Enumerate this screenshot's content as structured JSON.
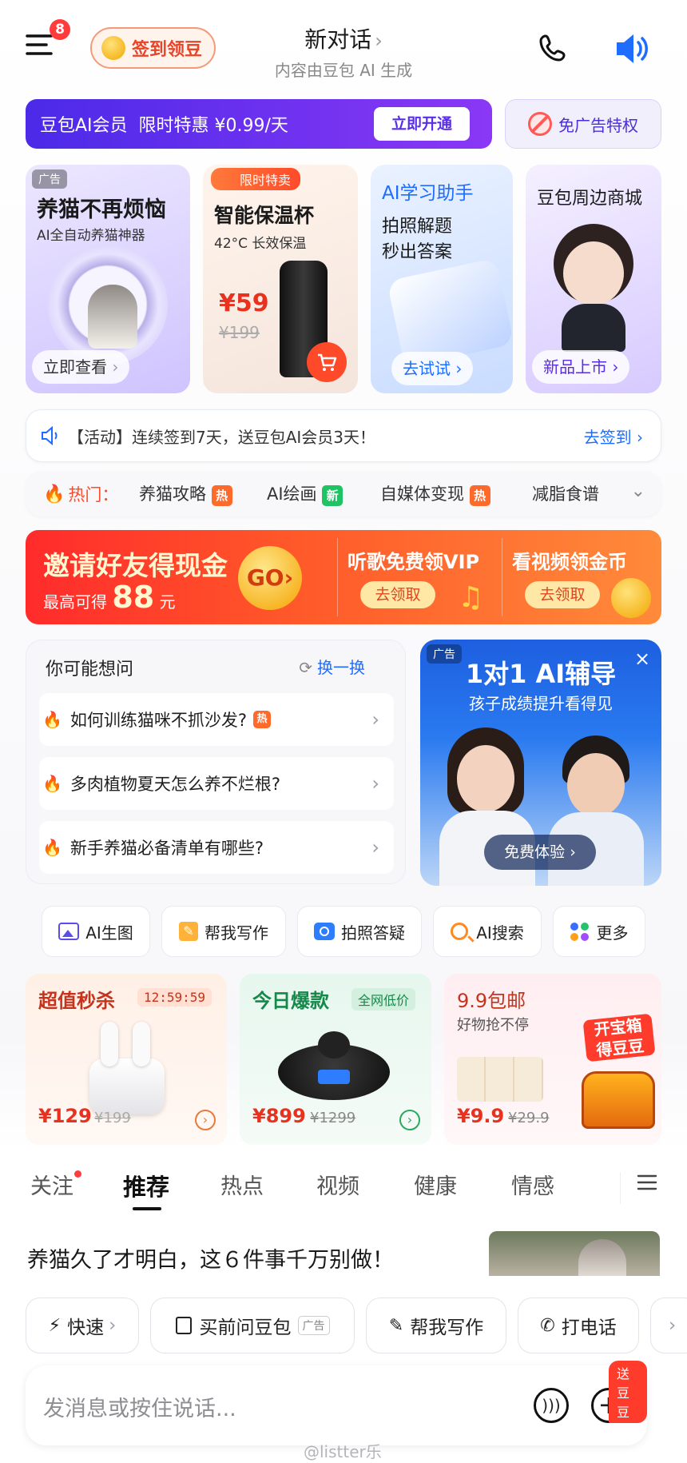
{
  "header": {
    "menu_badge": "8",
    "checkin_label": "签到领豆",
    "title": "新对话",
    "subtitle": "内容由豆包 AI 生成"
  },
  "member_banner": {
    "text": "豆包AI会员  限时特惠 ¥0.99/天",
    "cta": "立即开通",
    "adfree": "免广告特权"
  },
  "promo_cards": [
    {
      "ad_tag": "广告",
      "title": "养猫不再烦恼",
      "subtitle": "AI全自动养猫神器",
      "cta": "立即查看"
    },
    {
      "tag": "限时特卖",
      "title": "智能保温杯",
      "subtitle": "42°C 长效保温",
      "price": "¥59",
      "old_price": "¥199"
    },
    {
      "title": "AI学习助手",
      "subtitle": "拍照解题\n秒出答案",
      "cta": "去试试"
    },
    {
      "title": "豆包周边商城",
      "cta": "新品上市"
    }
  ],
  "activity": {
    "text": "【活动】连续签到7天，送豆包AI会员3天！",
    "cta": "去签到"
  },
  "hot_bar": {
    "label": "热门：",
    "items": [
      {
        "text": "养猫攻略",
        "tag": "热"
      },
      {
        "text": "AI绘画",
        "tag": "新"
      },
      {
        "text": "自媒体变现",
        "tag": "热"
      },
      {
        "text": "减脂食谱",
        "tag": ""
      }
    ]
  },
  "invite_banner": {
    "title": "邀请好友得现金",
    "sub_prefix": "最高可得",
    "amount": "88",
    "unit": "元",
    "go": "GO",
    "music_title": "听歌免费领VIP",
    "music_cta": "去领取",
    "video_title": "看视频领金币",
    "video_cta": "去领取"
  },
  "suggestions": {
    "title": "你可能想问",
    "refresh": "换一换",
    "items": [
      {
        "text": "如何训练猫咪不抓沙发?",
        "tag": "热"
      },
      {
        "text": "多肉植物夏天怎么养不烂根?",
        "tag": ""
      },
      {
        "text": "新手养猫必备清单有哪些?",
        "tag": ""
      }
    ]
  },
  "tutor_ad": {
    "ad_tag": "广告",
    "title": "1对1 AI辅导",
    "subtitle": "孩子成绩提升看得见",
    "cta": "免费体验"
  },
  "shortcuts": [
    "AI生图",
    "帮我写作",
    "拍照答疑",
    "AI搜索",
    "更多"
  ],
  "deals": [
    {
      "title": "超值秒杀",
      "timer": "12:59:59",
      "price": "¥129",
      "old_price": "¥199"
    },
    {
      "title": "今日爆款",
      "tag": "全网低价",
      "price": "¥899",
      "old_price": "¥1299"
    },
    {
      "title": "9.9包邮",
      "subtitle": "好物抢不停",
      "price": "¥9.9",
      "old_price": "¥29.9",
      "treasure": "开宝箱\n得豆豆"
    }
  ],
  "feed_tabs": [
    "关注",
    "推荐",
    "热点",
    "视频",
    "健康",
    "情感"
  ],
  "article": {
    "title": "养猫久了才明白，这６件事千万别做！"
  },
  "chips": [
    {
      "text": "快速"
    },
    {
      "text": "买前问豆包",
      "ad": "广告"
    },
    {
      "text": "帮我写作"
    },
    {
      "text": "打电话"
    }
  ],
  "input": {
    "placeholder": "发消息或按住说话...",
    "gift_badge": "送豆豆"
  },
  "watermark": "@listter乐",
  "colors": {
    "accent": "#6a3cf0",
    "brand_blue": "#1e6dff",
    "hot": "#ff4a2a"
  }
}
